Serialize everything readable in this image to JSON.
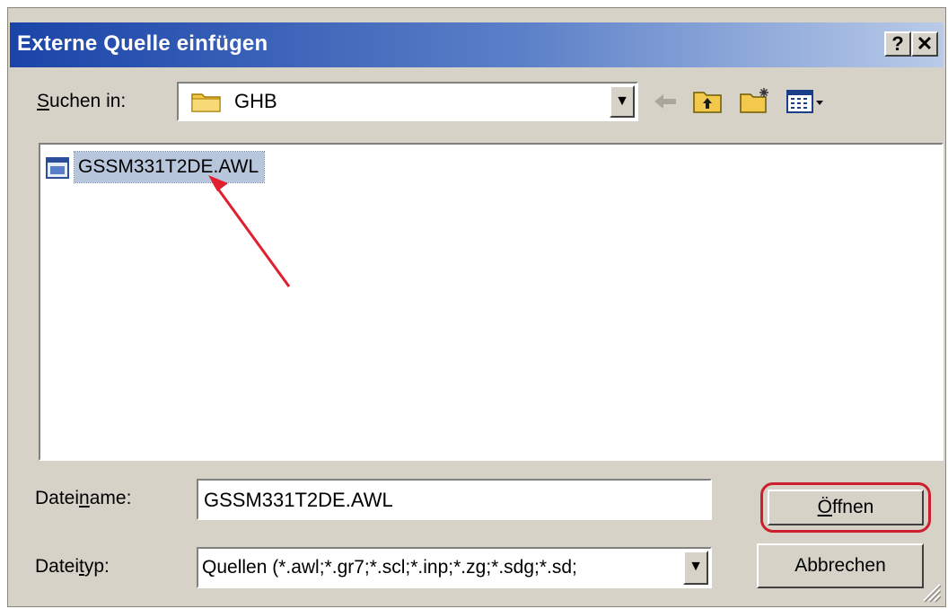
{
  "window": {
    "title": "Externe Quelle einfügen",
    "help_label": "?",
    "close_label": "✕"
  },
  "lookin": {
    "label_prefix": "S",
    "label_rest": "uchen in:",
    "value": "GHB"
  },
  "toolbar": {
    "icons": [
      "back-icon",
      "up-folder-icon",
      "new-folder-icon",
      "view-menu-icon"
    ]
  },
  "files": [
    {
      "name": "GSSM331T2DE.AWL",
      "icon": "awl-file-icon",
      "selected": true
    }
  ],
  "filename": {
    "label_a": "Datei",
    "label_u": "n",
    "label_b": "ame:",
    "value": "GSSM331T2DE.AWL"
  },
  "filetype": {
    "label_a": "Datei",
    "label_u": "t",
    "label_b": "yp:",
    "value": "Quellen (*.awl;*.gr7;*.scl;*.inp;*.zg;*.sdg;*.sd;"
  },
  "buttons": {
    "open_u": "Ö",
    "open_rest": "ffnen",
    "cancel": "Abbrechen"
  },
  "colors": {
    "title_start": "#1a44a8",
    "title_end": "#b9cbe8",
    "highlight_ring": "#cc1e2c",
    "arrow": "#e02030"
  }
}
